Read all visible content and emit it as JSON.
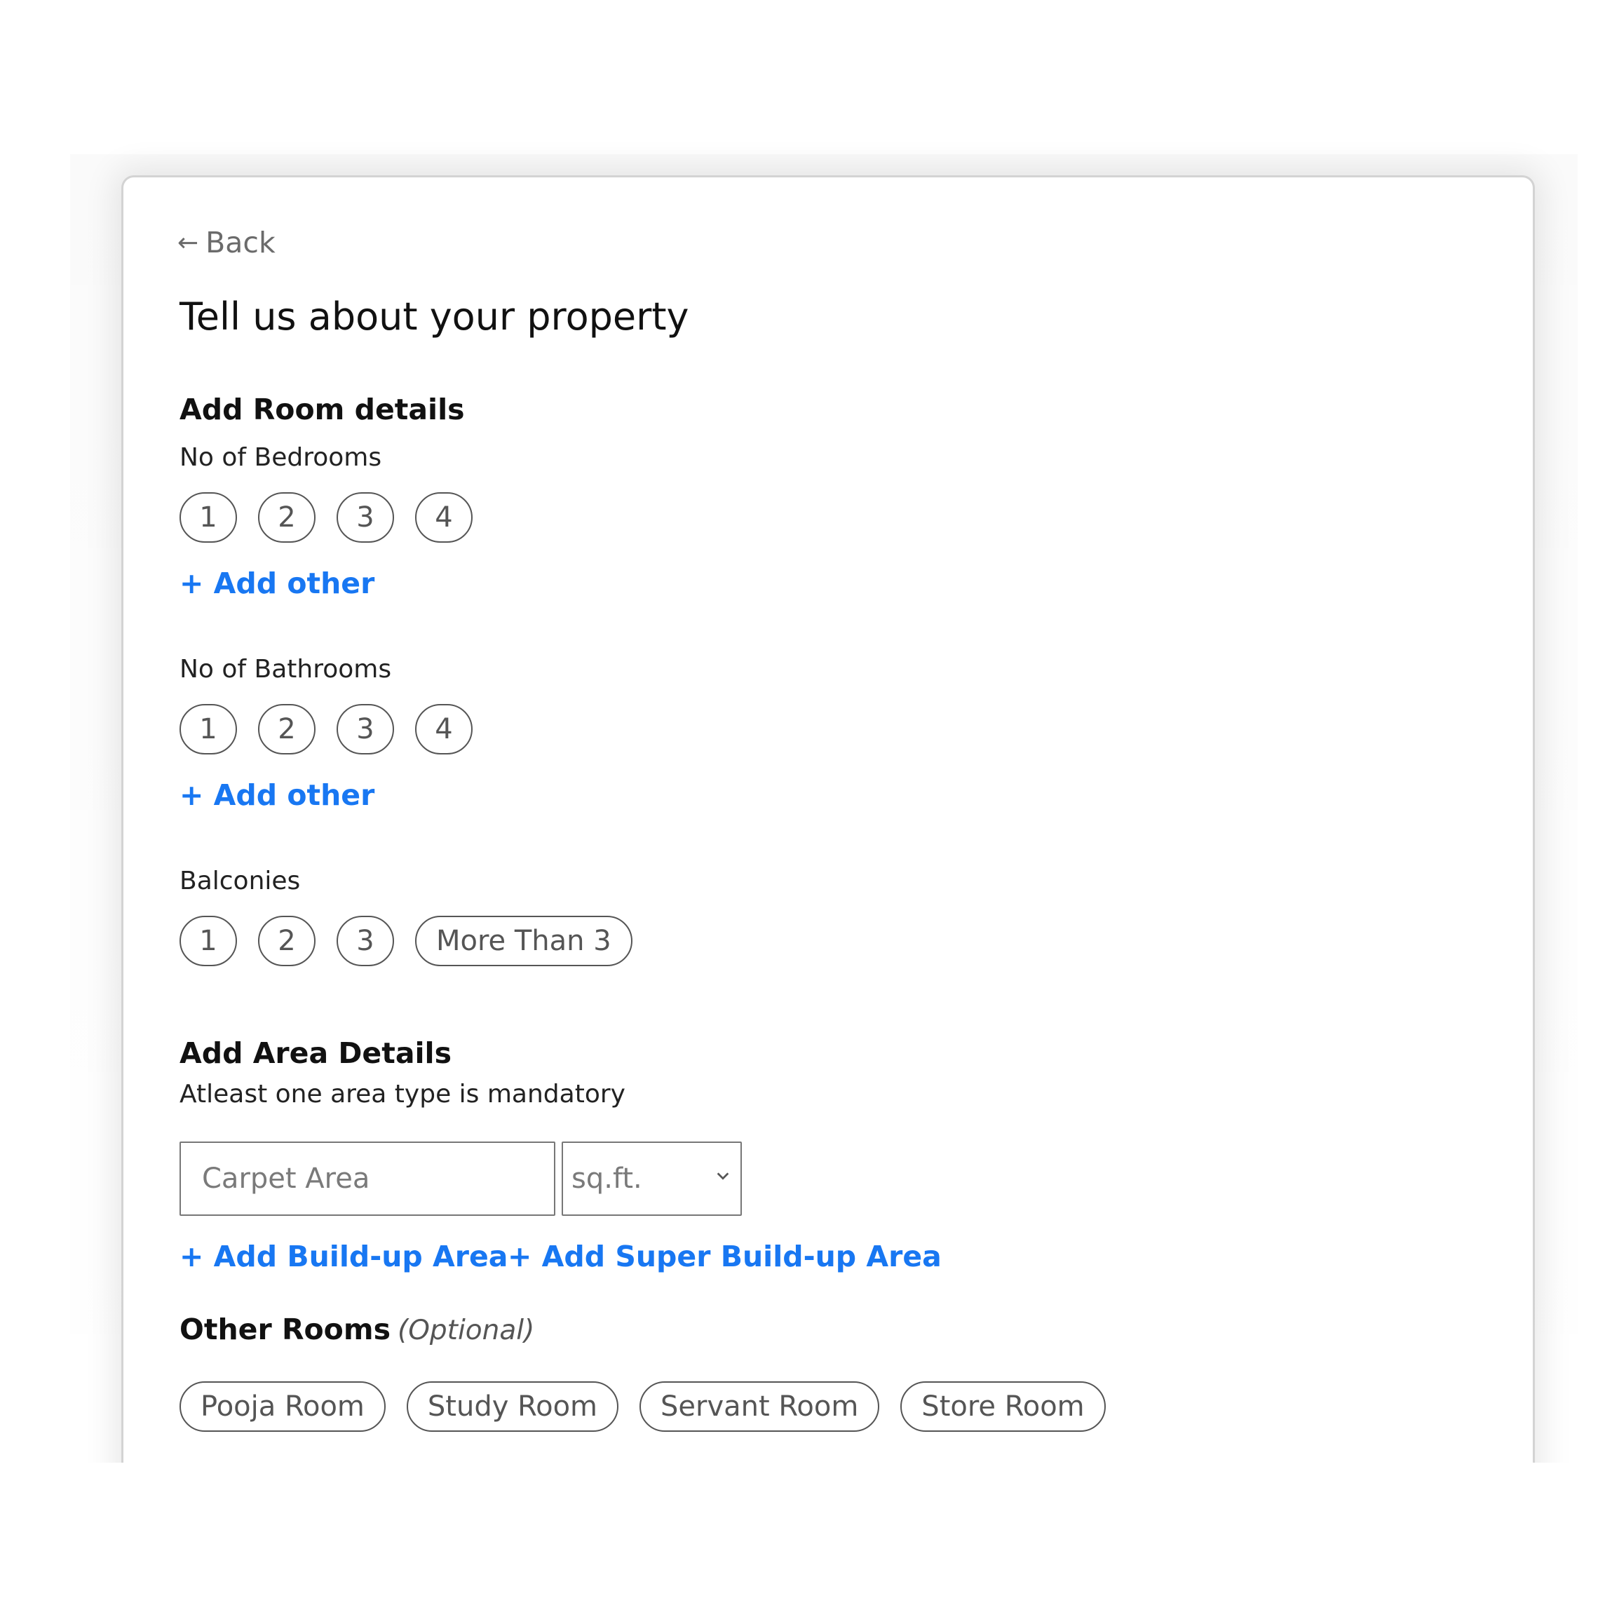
{
  "back": {
    "arrow": "←",
    "label": "Back"
  },
  "page_title": "Tell us about your property",
  "room_details": {
    "title": "Add Room details",
    "bedrooms": {
      "label": "No of Bedrooms",
      "options": [
        "1",
        "2",
        "3",
        "4"
      ],
      "add_other": "+ Add other"
    },
    "bathrooms": {
      "label": "No of Bathrooms",
      "options": [
        "1",
        "2",
        "3",
        "4"
      ],
      "add_other": "+ Add other"
    },
    "balconies": {
      "label": "Balconies",
      "options": [
        "1",
        "2",
        "3",
        "More Than 3"
      ]
    }
  },
  "area_details": {
    "title": "Add Area Details",
    "subtitle": "Atleast one area type is mandatory",
    "carpet_area_placeholder": "Carpet Area",
    "unit_selected": "sq.ft.",
    "add_build_up": "+ Add Build-up Area",
    "add_super_build_up": "+ Add Super Build-up Area"
  },
  "other_rooms": {
    "title": "Other Rooms",
    "optional": "(Optional)",
    "options": [
      "Pooja Room",
      "Study Room",
      "Servant Room",
      "Store Room"
    ]
  },
  "colors": {
    "link_blue": "#1877f2",
    "chip_border": "#555555",
    "card_border": "#d3d3d3"
  }
}
